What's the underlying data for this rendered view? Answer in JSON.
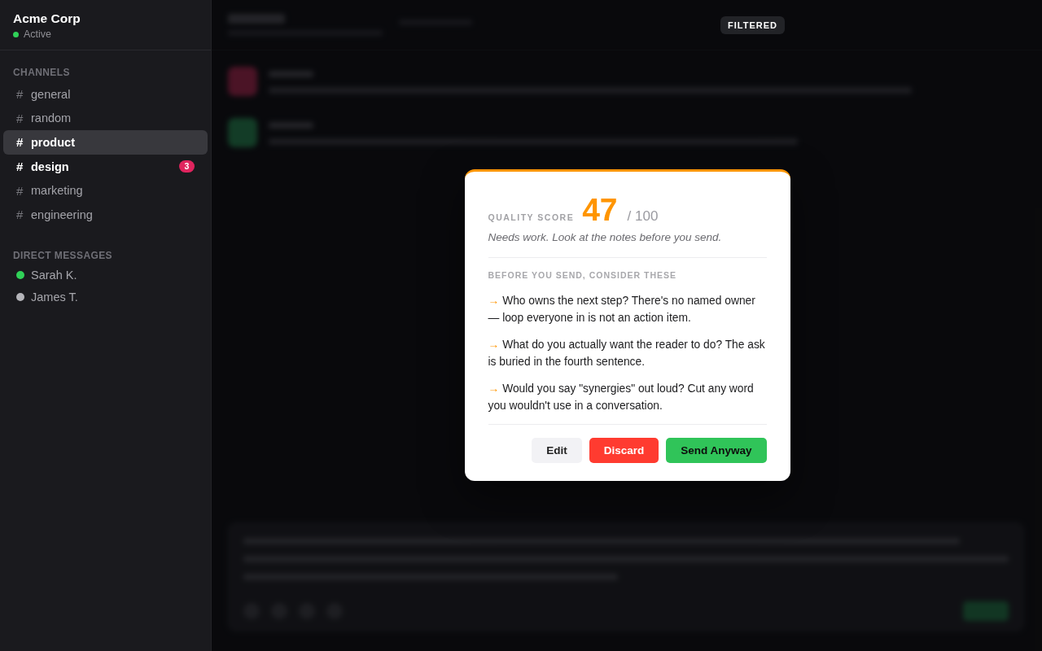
{
  "sidebar": {
    "workspace": {
      "name": "Acme Corp",
      "status": {
        "label": "Active",
        "color": "#30d158"
      }
    },
    "channels_heading": "CHANNELS",
    "channels": [
      {
        "symbol": "#",
        "name": "general",
        "selected": false,
        "unread": false
      },
      {
        "symbol": "#",
        "name": "random",
        "selected": false,
        "unread": false
      },
      {
        "symbol": "#",
        "name": "product",
        "selected": true,
        "unread": false
      },
      {
        "symbol": "#",
        "name": "design",
        "selected": false,
        "unread": true,
        "badge": "3"
      },
      {
        "symbol": "#",
        "name": "marketing",
        "selected": false,
        "unread": false
      },
      {
        "symbol": "#",
        "name": "engineering",
        "selected": false,
        "unread": false
      }
    ],
    "dm_heading": "DIRECT MESSAGES",
    "direct_messages": [
      {
        "name": "Sarah K.",
        "color": "#30d158"
      },
      {
        "name": "James T.",
        "color": "#b4b4b9"
      }
    ]
  },
  "main": {
    "blurred": true,
    "filter_badge": "FILTERED"
  },
  "quality_dialog": {
    "score_label": "QUALITY SCORE",
    "score": "47",
    "score_max": "/ 100",
    "verdict": "Needs work. Look at the notes before you send.",
    "notes_heading": "BEFORE YOU SEND, CONSIDER THESE",
    "notes": [
      {
        "marker": "→",
        "text": "Who owns the next step? There's no named owner — loop everyone in is not an action item."
      },
      {
        "marker": "→",
        "text": "What do you actually want the reader to do? The ask is buried in the fourth sentence."
      },
      {
        "marker": "→",
        "text": "Would you say \"synergies\" out loud? Cut any word you wouldn't use in a conversation."
      }
    ],
    "buttons": [
      {
        "label": "Edit",
        "kind": "secondary"
      },
      {
        "label": "Discard",
        "kind": "danger"
      },
      {
        "label": "Send Anyway",
        "kind": "primary"
      }
    ]
  }
}
